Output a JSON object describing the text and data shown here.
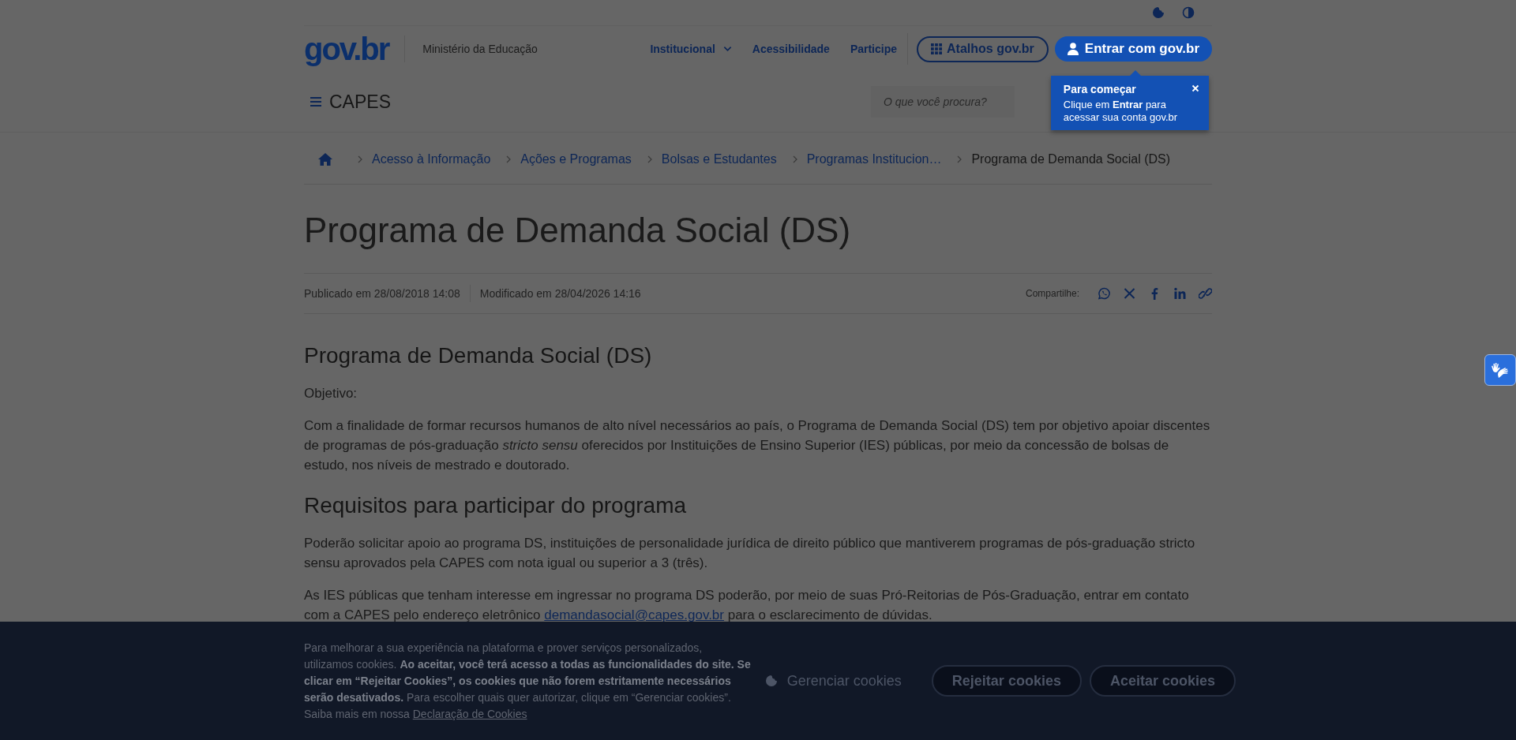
{
  "header": {
    "logo": "gov.br",
    "ministry": "Ministério da Educação",
    "nav": [
      {
        "label": "Institucional",
        "has_dropdown": true
      },
      {
        "label": "Acessibilidade",
        "has_dropdown": false
      },
      {
        "label": "Participe",
        "has_dropdown": false
      }
    ],
    "shortcuts_button": "Atalhos gov.br",
    "login_button": "Entrar com gov.br",
    "site_name": "CAPES",
    "search": {
      "placeholder": "O que você procura?"
    }
  },
  "tooltip": {
    "title": "Para começar",
    "text": "Clique em **Entrar** para acessar sua conta gov.br"
  },
  "breadcrumb": [
    {
      "label": "Acesso à Informação",
      "current": false
    },
    {
      "label": "Ações e Programas",
      "current": false
    },
    {
      "label": "Bolsas e Estudantes",
      "current": false
    },
    {
      "label": "Programas Institucion…",
      "current": false
    },
    {
      "label": "Programa de Demanda Social (DS)",
      "current": true
    }
  ],
  "page": {
    "title": "Programa de Demanda Social (DS)",
    "published": "Publicado em 28/08/2018 14:08",
    "modified": "Modificado em 28/04/2026 14:16",
    "share_label": "Compartilhe:"
  },
  "content": [
    {
      "kind": "heading",
      "text": "Programa de Demanda Social (DS)"
    },
    {
      "kind": "paragraph",
      "text": "Objetivo:"
    },
    {
      "kind": "paragraph",
      "text": "Com a finalidade de formar recursos humanos de alto nível necessários ao país, o Programa de Demanda Social (DS) tem por objetivo apoiar discentes de programas de pós-graduação *stricto sensu* oferecidos por Instituições de Ensino Superior (IES) públicas, por meio da concessão de bolsas de estudo, nos níveis de mestrado e doutorado."
    },
    {
      "kind": "heading",
      "text": "Requisitos para participar do programa"
    },
    {
      "kind": "paragraph",
      "text": "Poderão solicitar apoio ao programa DS, instituições de personalidade jurídica de direito público que mantiverem programas de pós-graduação stricto sensu aprovados pela CAPES com nota igual ou superior a 3 (três)."
    },
    {
      "kind": "link_paragraph",
      "text": "As IES públicas que tenham interesse em ingressar no programa DS poderão, por meio de suas Pró-Reitorias de Pós-Graduação, entrar em contato com a CAPES pelo endereço eletrônico ",
      "link": "demandasocial@capes.gov.br",
      "after": " para o esclarecimento de dúvidas."
    }
  ],
  "cookie_banner": {
    "text": "Para melhorar a sua experiência na plataforma e prover serviços personalizados, utilizamos cookies. **Ao aceitar, você terá acesso a todas as funcionalidades do site. Se clicar em “Rejeitar Cookies”, os cookies que não forem estritamente necessários serão desativados.** Para escolher quais quer autorizar, clique em “Gerenciar cookies”. Saiba mais em nossa ",
    "link": "Declaração de Cookies",
    "manage_button": "Gerenciar cookies",
    "reject_button": "Rejeitar cookies",
    "accept_button": "Aceitar cookies"
  }
}
